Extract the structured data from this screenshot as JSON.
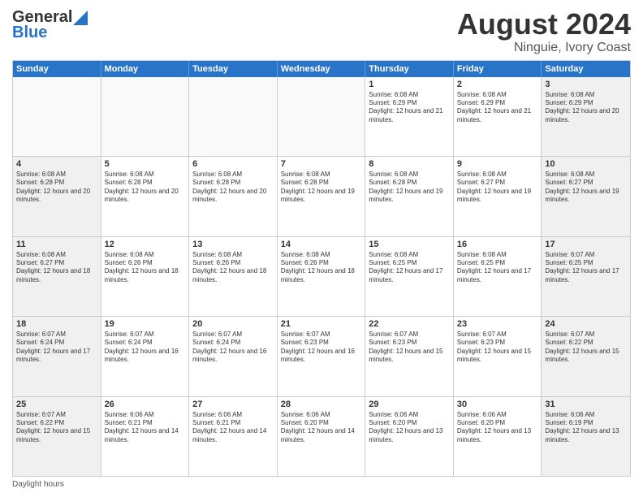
{
  "header": {
    "logo_general": "General",
    "logo_blue": "Blue",
    "main_title": "August 2024",
    "subtitle": "Ninguie, Ivory Coast"
  },
  "calendar": {
    "days": [
      "Sunday",
      "Monday",
      "Tuesday",
      "Wednesday",
      "Thursday",
      "Friday",
      "Saturday"
    ],
    "rows": [
      [
        {
          "day": "",
          "text": ""
        },
        {
          "day": "",
          "text": ""
        },
        {
          "day": "",
          "text": ""
        },
        {
          "day": "",
          "text": ""
        },
        {
          "day": "1",
          "text": "Sunrise: 6:08 AM\nSunset: 6:29 PM\nDaylight: 12 hours and 21 minutes."
        },
        {
          "day": "2",
          "text": "Sunrise: 6:08 AM\nSunset: 6:29 PM\nDaylight: 12 hours and 21 minutes."
        },
        {
          "day": "3",
          "text": "Sunrise: 6:08 AM\nSunset: 6:29 PM\nDaylight: 12 hours and 20 minutes."
        }
      ],
      [
        {
          "day": "4",
          "text": "Sunrise: 6:08 AM\nSunset: 6:28 PM\nDaylight: 12 hours and 20 minutes."
        },
        {
          "day": "5",
          "text": "Sunrise: 6:08 AM\nSunset: 6:28 PM\nDaylight: 12 hours and 20 minutes."
        },
        {
          "day": "6",
          "text": "Sunrise: 6:08 AM\nSunset: 6:28 PM\nDaylight: 12 hours and 20 minutes."
        },
        {
          "day": "7",
          "text": "Sunrise: 6:08 AM\nSunset: 6:28 PM\nDaylight: 12 hours and 19 minutes."
        },
        {
          "day": "8",
          "text": "Sunrise: 6:08 AM\nSunset: 6:28 PM\nDaylight: 12 hours and 19 minutes."
        },
        {
          "day": "9",
          "text": "Sunrise: 6:08 AM\nSunset: 6:27 PM\nDaylight: 12 hours and 19 minutes."
        },
        {
          "day": "10",
          "text": "Sunrise: 6:08 AM\nSunset: 6:27 PM\nDaylight: 12 hours and 19 minutes."
        }
      ],
      [
        {
          "day": "11",
          "text": "Sunrise: 6:08 AM\nSunset: 6:27 PM\nDaylight: 12 hours and 18 minutes."
        },
        {
          "day": "12",
          "text": "Sunrise: 6:08 AM\nSunset: 6:26 PM\nDaylight: 12 hours and 18 minutes."
        },
        {
          "day": "13",
          "text": "Sunrise: 6:08 AM\nSunset: 6:26 PM\nDaylight: 12 hours and 18 minutes."
        },
        {
          "day": "14",
          "text": "Sunrise: 6:08 AM\nSunset: 6:26 PM\nDaylight: 12 hours and 18 minutes."
        },
        {
          "day": "15",
          "text": "Sunrise: 6:08 AM\nSunset: 6:25 PM\nDaylight: 12 hours and 17 minutes."
        },
        {
          "day": "16",
          "text": "Sunrise: 6:08 AM\nSunset: 6:25 PM\nDaylight: 12 hours and 17 minutes."
        },
        {
          "day": "17",
          "text": "Sunrise: 6:07 AM\nSunset: 6:25 PM\nDaylight: 12 hours and 17 minutes."
        }
      ],
      [
        {
          "day": "18",
          "text": "Sunrise: 6:07 AM\nSunset: 6:24 PM\nDaylight: 12 hours and 17 minutes."
        },
        {
          "day": "19",
          "text": "Sunrise: 6:07 AM\nSunset: 6:24 PM\nDaylight: 12 hours and 16 minutes."
        },
        {
          "day": "20",
          "text": "Sunrise: 6:07 AM\nSunset: 6:24 PM\nDaylight: 12 hours and 16 minutes."
        },
        {
          "day": "21",
          "text": "Sunrise: 6:07 AM\nSunset: 6:23 PM\nDaylight: 12 hours and 16 minutes."
        },
        {
          "day": "22",
          "text": "Sunrise: 6:07 AM\nSunset: 6:23 PM\nDaylight: 12 hours and 15 minutes."
        },
        {
          "day": "23",
          "text": "Sunrise: 6:07 AM\nSunset: 6:23 PM\nDaylight: 12 hours and 15 minutes."
        },
        {
          "day": "24",
          "text": "Sunrise: 6:07 AM\nSunset: 6:22 PM\nDaylight: 12 hours and 15 minutes."
        }
      ],
      [
        {
          "day": "25",
          "text": "Sunrise: 6:07 AM\nSunset: 6:22 PM\nDaylight: 12 hours and 15 minutes."
        },
        {
          "day": "26",
          "text": "Sunrise: 6:06 AM\nSunset: 6:21 PM\nDaylight: 12 hours and 14 minutes."
        },
        {
          "day": "27",
          "text": "Sunrise: 6:06 AM\nSunset: 6:21 PM\nDaylight: 12 hours and 14 minutes."
        },
        {
          "day": "28",
          "text": "Sunrise: 6:06 AM\nSunset: 6:20 PM\nDaylight: 12 hours and 14 minutes."
        },
        {
          "day": "29",
          "text": "Sunrise: 6:06 AM\nSunset: 6:20 PM\nDaylight: 12 hours and 13 minutes."
        },
        {
          "day": "30",
          "text": "Sunrise: 6:06 AM\nSunset: 6:20 PM\nDaylight: 12 hours and 13 minutes."
        },
        {
          "day": "31",
          "text": "Sunrise: 6:06 AM\nSunset: 6:19 PM\nDaylight: 12 hours and 13 minutes."
        }
      ]
    ]
  },
  "footer": {
    "text": "Daylight hours"
  }
}
